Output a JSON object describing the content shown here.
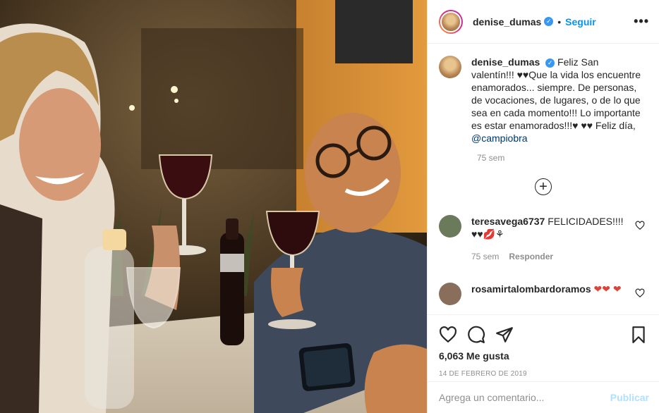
{
  "post": {
    "username": "denise_dumas",
    "follow_label": "Seguir",
    "dot": "•",
    "more_label": "•••",
    "caption_text": "Feliz San valentín!!! ♥♥Que la vida los encuentre enamorados... siempre. De personas, de vocaciones, de lugares, o de lo que sea en cada momento!!! Lo importante es estar enamorados!!!♥ ♥♥ Feliz día, ",
    "caption_mention": "@campiobra",
    "caption_time": "75 sem",
    "load_more": "+"
  },
  "comments": [
    {
      "username": "teresavega6737",
      "text": "FELICIDADES!!!! ♥♥💋⚘",
      "time": "75 sem",
      "reply_label": "Responder",
      "avatar_color": "#6a7a5a"
    },
    {
      "username": "rosamirtalombardoramos",
      "text": "❤❤ ❤",
      "avatar_color": "#8a6e5c"
    }
  ],
  "actions": {
    "likes": "6,063 Me gusta",
    "date": "14 DE FEBRERO DE 2019"
  },
  "add_comment": {
    "placeholder": "Agrega un comentario...",
    "publish_label": "Publicar"
  },
  "colors": {
    "accent": "#0095f6",
    "publish_disabled": "#b2dffc",
    "verified": "#3897f0"
  }
}
